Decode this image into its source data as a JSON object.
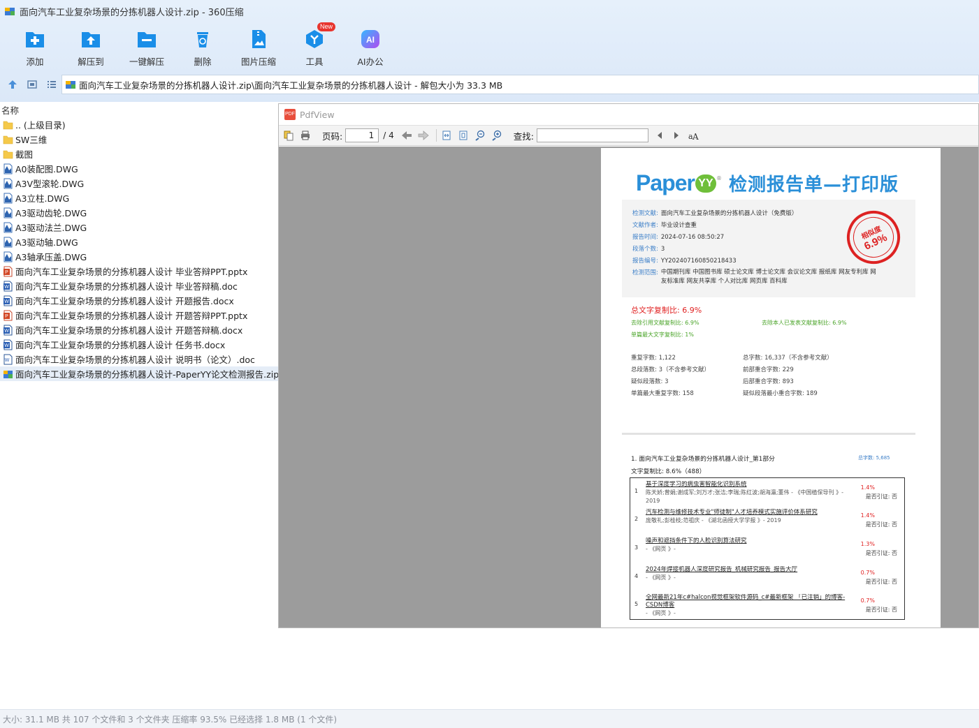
{
  "window": {
    "title": "面向汽车工业复杂场景的分拣机器人设计.zip - 360压缩"
  },
  "toolbar": {
    "buttons": [
      {
        "label": "添加",
        "icon": "add-icon"
      },
      {
        "label": "解压到",
        "icon": "extract-to-icon"
      },
      {
        "label": "一键解压",
        "icon": "one-click-extract-icon"
      },
      {
        "label": "删除",
        "icon": "delete-icon"
      },
      {
        "label": "图片压缩",
        "icon": "image-compress-icon"
      },
      {
        "label": "工具",
        "icon": "tools-icon",
        "badge": "New"
      },
      {
        "label": "AI办公",
        "icon": "ai-office-icon",
        "icon_text": "AI"
      }
    ]
  },
  "address": {
    "path": "面向汽车工业复杂场景的分拣机器人设计.zip\\面向汽车工业复杂场景的分拣机器人设计 - 解包大小为 33.3 MB"
  },
  "filelist": {
    "column_name": "名称",
    "items": [
      {
        "name": ".. (上级目录)",
        "type": "folder"
      },
      {
        "name": "SW三维",
        "type": "folder"
      },
      {
        "name": "截图",
        "type": "folder"
      },
      {
        "name": "A0装配图.DWG",
        "type": "dwg"
      },
      {
        "name": "A3V型滚轮.DWG",
        "type": "dwg"
      },
      {
        "name": "A3立柱.DWG",
        "type": "dwg"
      },
      {
        "name": "A3驱动齿轮.DWG",
        "type": "dwg"
      },
      {
        "name": "A3驱动法兰.DWG",
        "type": "dwg"
      },
      {
        "name": "A3驱动轴.DWG",
        "type": "dwg"
      },
      {
        "name": "A3轴承压盖.DWG",
        "type": "dwg"
      },
      {
        "name": "面向汽车工业复杂场景的分拣机器人设计 毕业答辩PPT.pptx",
        "type": "pptx"
      },
      {
        "name": "面向汽车工业复杂场景的分拣机器人设计 毕业答辩稿.doc",
        "type": "doc"
      },
      {
        "name": "面向汽车工业复杂场景的分拣机器人设计 开题报告.docx",
        "type": "doc"
      },
      {
        "name": "面向汽车工业复杂场景的分拣机器人设计 开题答辩PPT.pptx",
        "type": "pptx"
      },
      {
        "name": "面向汽车工业复杂场景的分拣机器人设计 开题答辩稿.docx",
        "type": "doc"
      },
      {
        "name": "面向汽车工业复杂场景的分拣机器人设计 任务书.docx",
        "type": "doc"
      },
      {
        "name": "面向汽车工业复杂场景的分拣机器人设计 说明书（论文）.doc",
        "type": "doc-outline"
      },
      {
        "name": "面向汽车工业复杂场景的分拣机器人设计-PaperYY论文检测报告.zip",
        "type": "zip",
        "selected": true
      }
    ]
  },
  "pdfview": {
    "title": "PdfView",
    "page_label": "页码:",
    "page_current": "1",
    "page_total": "/ 4",
    "find_label": "查找:"
  },
  "report": {
    "logo_text": "Paper",
    "logo_yy": "YY",
    "logo_reg": "®",
    "title": "检测报告单—打印版",
    "info": [
      {
        "key": "检测文献:",
        "value": "面向汽车工业复杂场景的分拣机器人设计（免费版）"
      },
      {
        "key": "文献作者:",
        "value": "毕业设计查重"
      },
      {
        "key": "报告时间:",
        "value": "2024-07-16 08:50:27"
      },
      {
        "key": "段落个数:",
        "value": "3"
      },
      {
        "key": "报告编号:",
        "value": "YY202407160850218433"
      },
      {
        "key": "检测范围:",
        "value": "中国期刊库  中国图书库  硕士论文库  博士论文库  会议论文库  报纸库  网友专利库  网友标准库  网友共享库  个人对比库  网页库  百科库"
      }
    ],
    "stamp_label": "相似度",
    "stamp_value": "6.9%",
    "total_ratio": "总文字复制比: 6.9%",
    "excl_ref": "去除引用文献复制比: 6.9%",
    "excl_self": "去除本人已发表文献复制比: 6.9%",
    "max_single": "单篇最大文字复制比: 1%",
    "stats": {
      "dup_chars": "重复字数: 1,122",
      "total_chars": "总字数: 16,337（不含参考文献）",
      "total_paras": "总段落数: 3（不含参考文献）",
      "front_overlap": "前部重合字数: 229",
      "suspect_paras": "疑似段落数: 3",
      "back_overlap": "后部重合字数: 893",
      "max_single_dup": "单篇最大重复字数: 158",
      "min_suspect_overlap": "疑似段落最小重合字数: 189"
    },
    "part": {
      "title": "1. 面向汽车工业复杂场景的分拣机器人设计_第1部分",
      "total": "总字数: 5,685",
      "ratio": "文字复制比: 8.6%（488）"
    },
    "matches": [
      {
        "num": "1",
        "title": "基于深度学习的病虫害智能化识别系统",
        "meta": "陈天娇;曾娟;谢成军;刘万才;张洁;李瑞;陈红波;胡海瀛;董伟 - 《中国植保导刊 》- 2019",
        "pct": "1.4%",
        "cite": "是否引证: 否"
      },
      {
        "num": "2",
        "title": "汽车检测与维修技术专业\"师徒制\"人才培养模式实施评价体系研究",
        "meta": "庞敬礼;彭桂枝;范祖庆 - 《湖北函授大学学报 》- 2019",
        "pct": "1.4%",
        "cite": "是否引证: 否"
      },
      {
        "num": "3",
        "title": "噪声和遮挡条件下的人脸识别算法研究",
        "meta": "- 《网页 》-",
        "pct": "1.3%",
        "cite": "是否引证: 否"
      },
      {
        "num": "4",
        "title": "2024年焊接机器人深度研究报告_机械研究报告_报告大厅",
        "meta": "- 《网页 》-",
        "pct": "0.7%",
        "cite": "是否引证: 否"
      },
      {
        "num": "5",
        "title": "全网最新21年c#halcon视觉框架软件源码_c#最新框架 「已注销」的博客-CSDN博客",
        "meta": "- 《网页 》-",
        "pct": "0.7%",
        "cite": "是否引证: 否"
      }
    ]
  },
  "status": {
    "text": "大小: 31.1 MB 共 107 个文件和 3 个文件夹 压缩率 93.5% 已经选择 1.8 MB (1 个文件)"
  },
  "colors": {
    "toolbar_icon_blue": "#1a8ee8",
    "accent_red": "#e02020",
    "report_blue": "#2a8fd8",
    "report_green": "#4aa428"
  }
}
